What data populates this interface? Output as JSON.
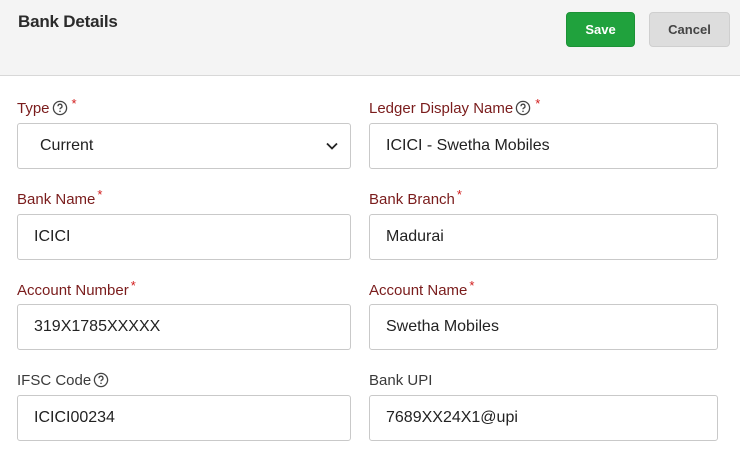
{
  "header": {
    "title": "Bank Details",
    "save_label": "Save",
    "cancel_label": "Cancel"
  },
  "form": {
    "type": {
      "label": "Type",
      "required_mark": "*",
      "value": "Current"
    },
    "ledger_display_name": {
      "label": "Ledger Display Name",
      "required_mark": "*",
      "value": "ICICI - Swetha Mobiles"
    },
    "bank_name": {
      "label": "Bank Name",
      "required_mark": "*",
      "value": "ICICI"
    },
    "bank_branch": {
      "label": "Bank Branch",
      "required_mark": "*",
      "value": "Madurai"
    },
    "account_number": {
      "label": "Account Number",
      "required_mark": "*",
      "value": "319X1785XXXXX"
    },
    "account_name": {
      "label": "Account Name",
      "required_mark": "*",
      "value": "Swetha Mobiles"
    },
    "ifsc_code": {
      "label": "IFSC Code",
      "value": "ICICI00234"
    },
    "bank_upi": {
      "label": "Bank UPI",
      "value": "7689XX24X1@upi"
    }
  },
  "icons": {
    "help": "question-circle-icon",
    "dropdown": "chevron-down-icon"
  },
  "colors": {
    "save": "#20a23d",
    "label": "#7a1c1c",
    "required": "#d11a1a"
  }
}
